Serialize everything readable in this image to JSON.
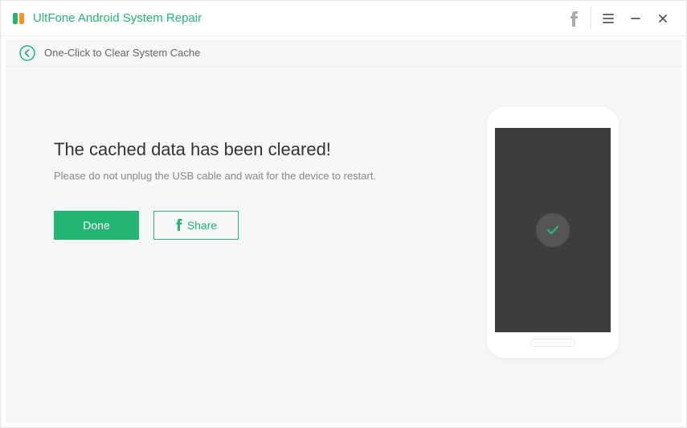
{
  "titlebar": {
    "app_title": "UltFone Android System Repair"
  },
  "breadcrumb": {
    "text": "One-Click to Clear System Cache"
  },
  "content": {
    "heading": "The cached data has been cleared!",
    "subtext": "Please do not unplug the USB cable and wait for the device to restart.",
    "done_label": "Done",
    "share_label": "Share"
  },
  "colors": {
    "accent": "#22b573"
  }
}
